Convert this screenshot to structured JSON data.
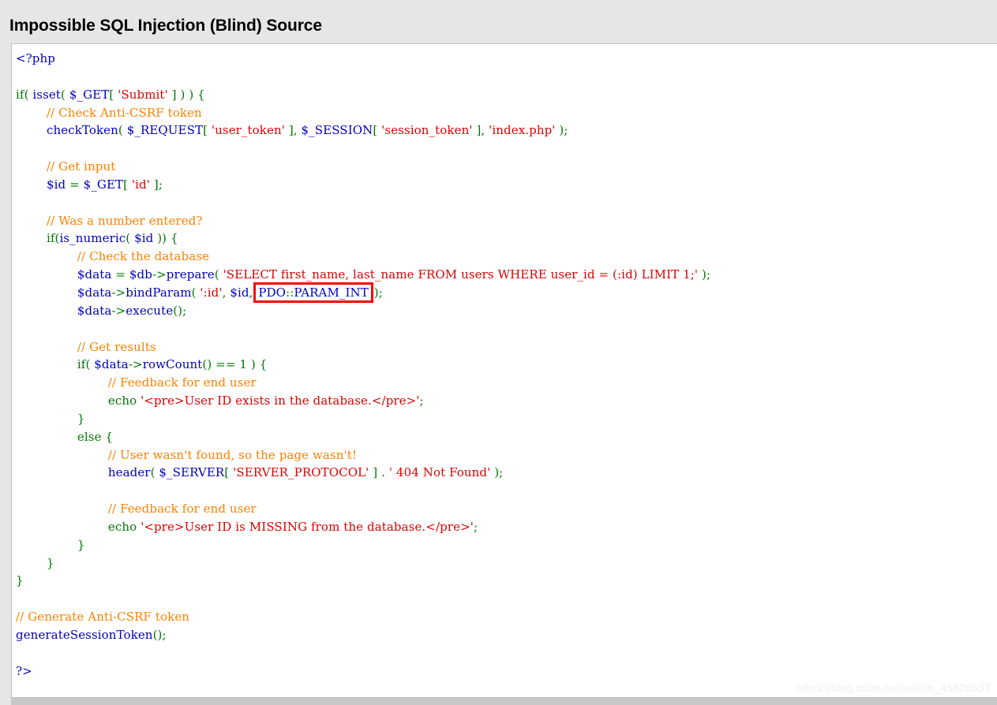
{
  "page": {
    "title": "Impossible SQL Injection (Blind) Source",
    "background_color": "#e6e6e6",
    "code_background_color": "#ffffff",
    "highlight_color": "#FF0000"
  },
  "watermark": {
    "text": "https://blog.csdn.net/weixin_45626537"
  },
  "source": {
    "language": "php",
    "highlighted_token": "PDO::PARAM_INT",
    "lines": [
      "<?php",
      "",
      "if( isset( $_GET[ 'Submit' ] ) ) {",
      "        // Check Anti-CSRF token",
      "        checkToken( $_REQUEST[ 'user_token' ], $_SESSION[ 'session_token' ], 'index.php' );",
      "",
      "        // Get input",
      "        $id = $_GET[ 'id' ];",
      "",
      "        // Was a number entered?",
      "        if(is_numeric( $id )) {",
      "                // Check the database",
      "                $data = $db->prepare( 'SELECT first_name, last_name FROM users WHERE user_id = (:id) LIMIT 1;' );",
      "                $data->bindParam( ':id', $id, PDO::PARAM_INT );",
      "                $data->execute();",
      "",
      "                // Get results",
      "                if( $data->rowCount() == 1 ) {",
      "                        // Feedback for end user",
      "                        echo '<pre>User ID exists in the database.</pre>';",
      "                }",
      "                else {",
      "                        // User wasn't found, so the page wasn't!",
      "                        header( $_SERVER[ 'SERVER_PROTOCOL' ] . ' 404 Not Found' );",
      "",
      "                        // Feedback for end user",
      "                        echo '<pre>User ID is MISSING from the database.</pre>';",
      "                }",
      "        }",
      "}",
      "",
      "// Generate Anti-CSRF token",
      "generateSessionToken();",
      "",
      "?>"
    ]
  }
}
